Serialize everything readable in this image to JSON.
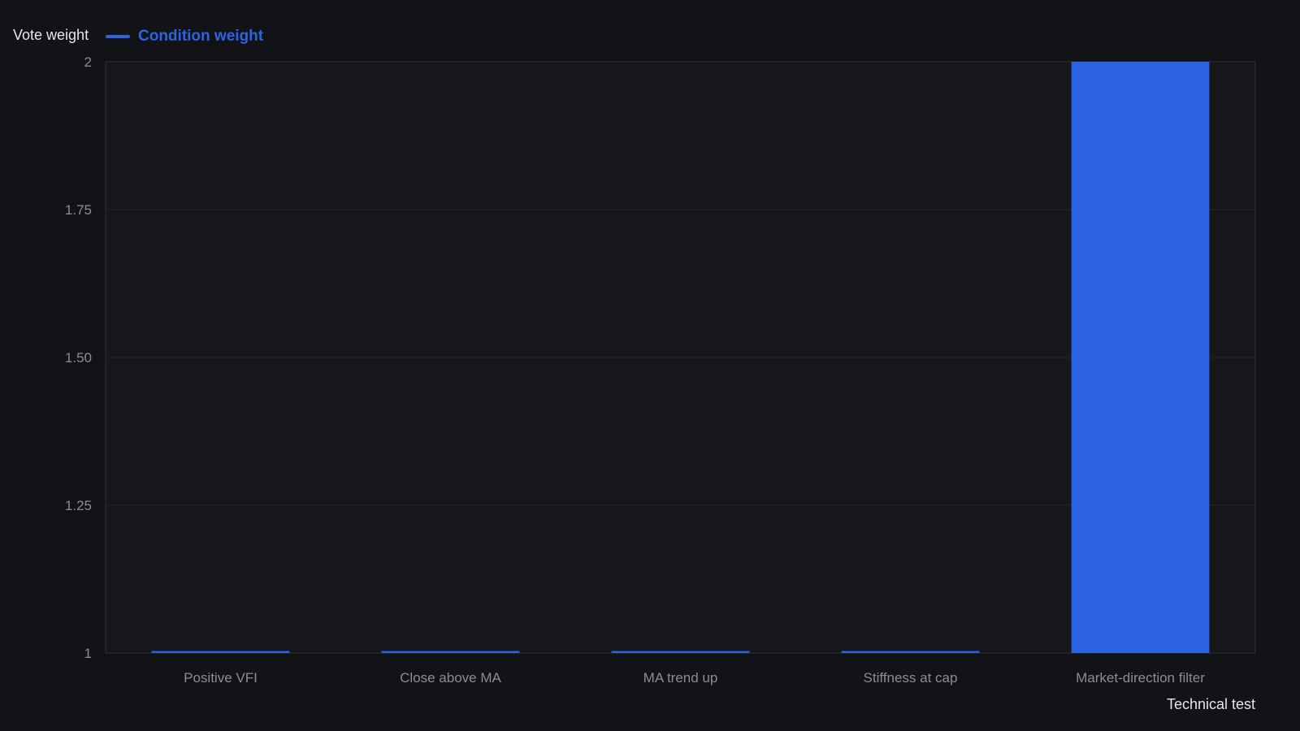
{
  "chart_data": {
    "type": "bar",
    "ylabel": "Vote weight",
    "xlabel": "Technical test",
    "ylim": [
      1,
      2
    ],
    "yticks": [
      1,
      1.25,
      1.5,
      1.75,
      2
    ],
    "ytick_labels": [
      "1",
      "1.25",
      "1.50",
      "1.75",
      "2"
    ],
    "categories": [
      "Positive VFI",
      "Close above MA",
      "MA trend up",
      "Stiffness at cap",
      "Market-direction filter"
    ],
    "series": [
      {
        "name": "Condition weight",
        "values": [
          1,
          1,
          1,
          1,
          2
        ],
        "color": "#2b63e3"
      }
    ],
    "grid": true,
    "legend": "top-left"
  },
  "colors": {
    "background": "#111317",
    "plot_background": "#15171b",
    "grid": "#23262c",
    "axis": "#2e3138",
    "tick_text": "#8a8d93",
    "label_text": "#e6e6e6"
  }
}
